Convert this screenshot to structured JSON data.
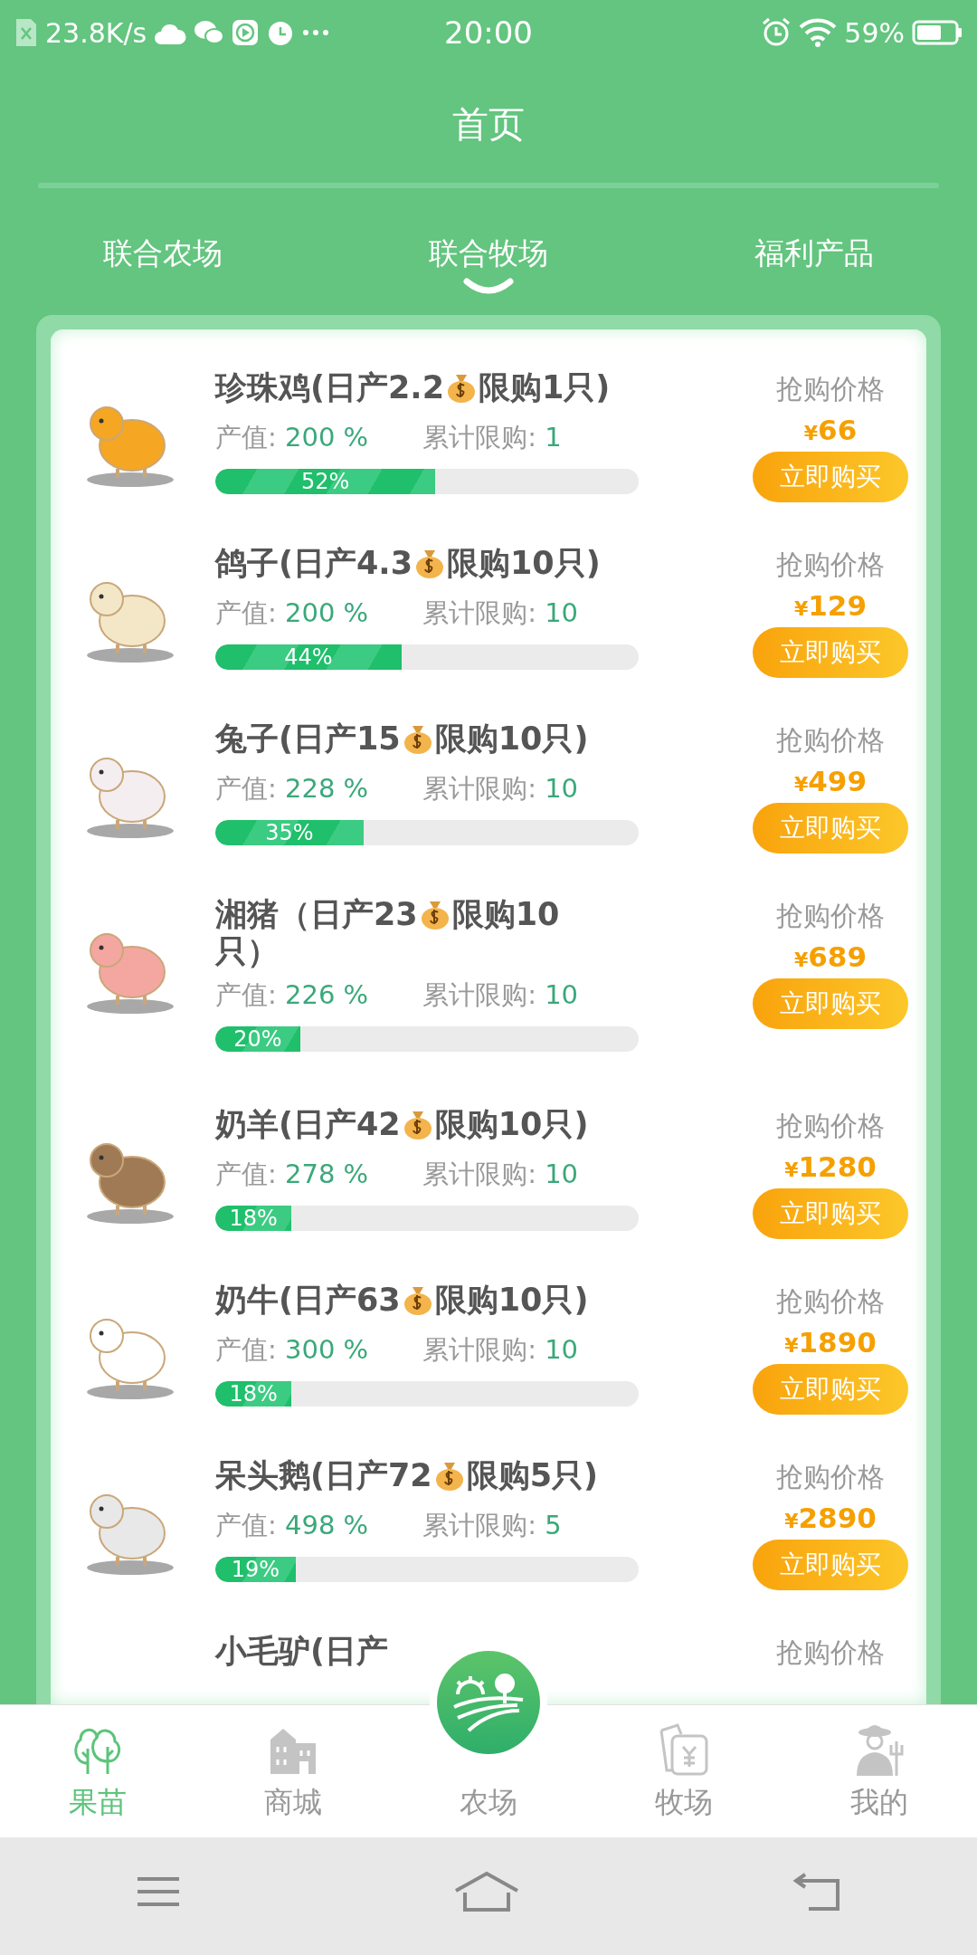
{
  "status_bar": {
    "speed": "23.8K/s",
    "time": "20:00",
    "battery": "59%"
  },
  "header": {
    "title": "首页"
  },
  "tabs": [
    {
      "label": "联合农场",
      "selected": false
    },
    {
      "label": "联合牧场",
      "selected": true
    },
    {
      "label": "福利产品",
      "selected": false
    }
  ],
  "products": [
    {
      "title": {
        "before": "珍珠鸡(日产2.2",
        "after": "限购1只)"
      },
      "value_label": "产值:",
      "value": "200 %",
      "limit_label": "累计限购:",
      "limit": "1",
      "level": 0.52,
      "percent": "52%",
      "price_label": "抢购价格",
      "currency": "¥",
      "price": "66",
      "button": "立即购买"
    },
    {
      "title": {
        "before": "鸽子(日产4.3",
        "after": "限购10只)"
      },
      "value_label": "产值:",
      "value": "200 %",
      "limit_label": "累计限购:",
      "limit": "10",
      "level": 0.44,
      "percent": "44%",
      "price_label": "抢购价格",
      "currency": "¥",
      "price": "129",
      "button": "立即购买"
    },
    {
      "title": {
        "before": "兔子(日产15",
        "after": "限购10只)"
      },
      "value_label": "产值:",
      "value": "228 %",
      "limit_label": "累计限购:",
      "limit": "10",
      "level": 0.35,
      "percent": "35%",
      "price_label": "抢购价格",
      "currency": "¥",
      "price": "499",
      "button": "立即购买"
    },
    {
      "title": {
        "before": "湘猪（日产23",
        "after": "限购10"
      },
      "title_continued": "只）",
      "value_label": "产值:",
      "value": "226 %",
      "limit_label": "累计限购:",
      "limit": "10",
      "level": 0.2,
      "percent": "20%",
      "price_label": "抢购价格",
      "currency": "¥",
      "price": "689",
      "button": "立即购买"
    },
    {
      "title": {
        "before": "奶羊(日产42",
        "after": "限购10只)"
      },
      "value_label": "产值:",
      "value": "278 %",
      "limit_label": "累计限购:",
      "limit": "10",
      "level": 0.18,
      "percent": "18%",
      "price_label": "抢购价格",
      "currency": "¥",
      "price": "1280",
      "button": "立即购买"
    },
    {
      "title": {
        "before": "奶牛(日产63",
        "after": "限购10只)"
      },
      "value_label": "产值:",
      "value": "300 %",
      "limit_label": "累计限购:",
      "limit": "10",
      "level": 0.18,
      "percent": "18%",
      "price_label": "抢购价格",
      "currency": "¥",
      "price": "1890",
      "button": "立即购买"
    },
    {
      "title": {
        "before": "呆头鹅(日产72",
        "after": "限购5只)"
      },
      "value_label": "产值:",
      "value": "498 %",
      "limit_label": "累计限购:",
      "limit": "5",
      "level": 0.19,
      "percent": "19%",
      "price_label": "抢购价格",
      "currency": "¥",
      "price": "2890",
      "button": "立即购买"
    }
  ],
  "partial_product": {
    "title": "小毛驴(日产",
    "price_label": "抢购价格"
  },
  "bottom_nav": [
    {
      "label": "果苗",
      "kind": "tree",
      "selected": true
    },
    {
      "label": "商城",
      "kind": "shop",
      "selected": false
    },
    {
      "label": "农场",
      "kind": "farm",
      "selected": false
    },
    {
      "label": "牧场",
      "kind": "bag",
      "selected": false
    },
    {
      "label": "我的",
      "kind": "farmer",
      "selected": false
    }
  ]
}
